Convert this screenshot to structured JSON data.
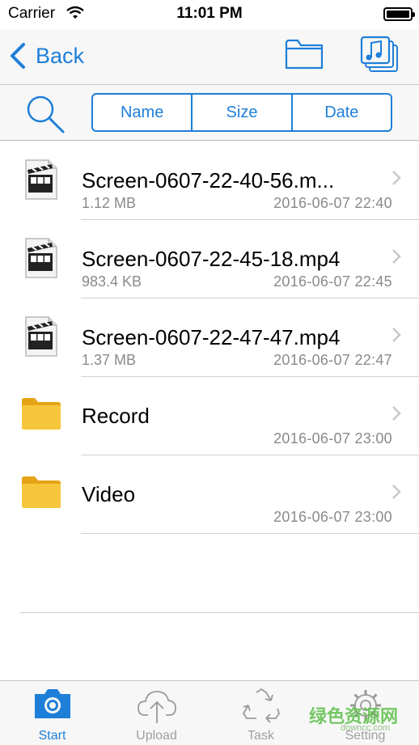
{
  "status_bar": {
    "carrier": "Carrier",
    "time": "11:01 PM"
  },
  "nav": {
    "back_label": "Back",
    "folder_icon": "folder-icon",
    "music_icon": "music-files-icon"
  },
  "sort": {
    "options": [
      "Name",
      "Size",
      "Date"
    ]
  },
  "files": [
    {
      "name": "Screen-0607-22-40-56.m...",
      "size": "1.12 MB",
      "date": "2016-06-07 22:40",
      "type": "video"
    },
    {
      "name": "Screen-0607-22-45-18.mp4",
      "size": "983.4 KB",
      "date": "2016-06-07 22:45",
      "type": "video"
    },
    {
      "name": "Screen-0607-22-47-47.mp4",
      "size": "1.37 MB",
      "date": "2016-06-07 22:47",
      "type": "video"
    },
    {
      "name": "Record",
      "size": "",
      "date": "2016-06-07 23:00",
      "type": "folder"
    },
    {
      "name": "Video",
      "size": "",
      "date": "2016-06-07 23:00",
      "type": "folder"
    }
  ],
  "tabs": [
    {
      "label": "Start",
      "icon": "camera-icon",
      "active": true
    },
    {
      "label": "Upload",
      "icon": "cloud-upload-icon",
      "active": false
    },
    {
      "label": "Task",
      "icon": "recycle-icon",
      "active": false
    },
    {
      "label": "Setting",
      "icon": "gear-icon",
      "active": false
    }
  ],
  "watermark": {
    "text": "绿色资源网",
    "sub": "downcc.com"
  },
  "colors": {
    "accent": "#1e7fd9",
    "secondary_text": "#8a8a8a",
    "folder": "#f2b92a"
  }
}
